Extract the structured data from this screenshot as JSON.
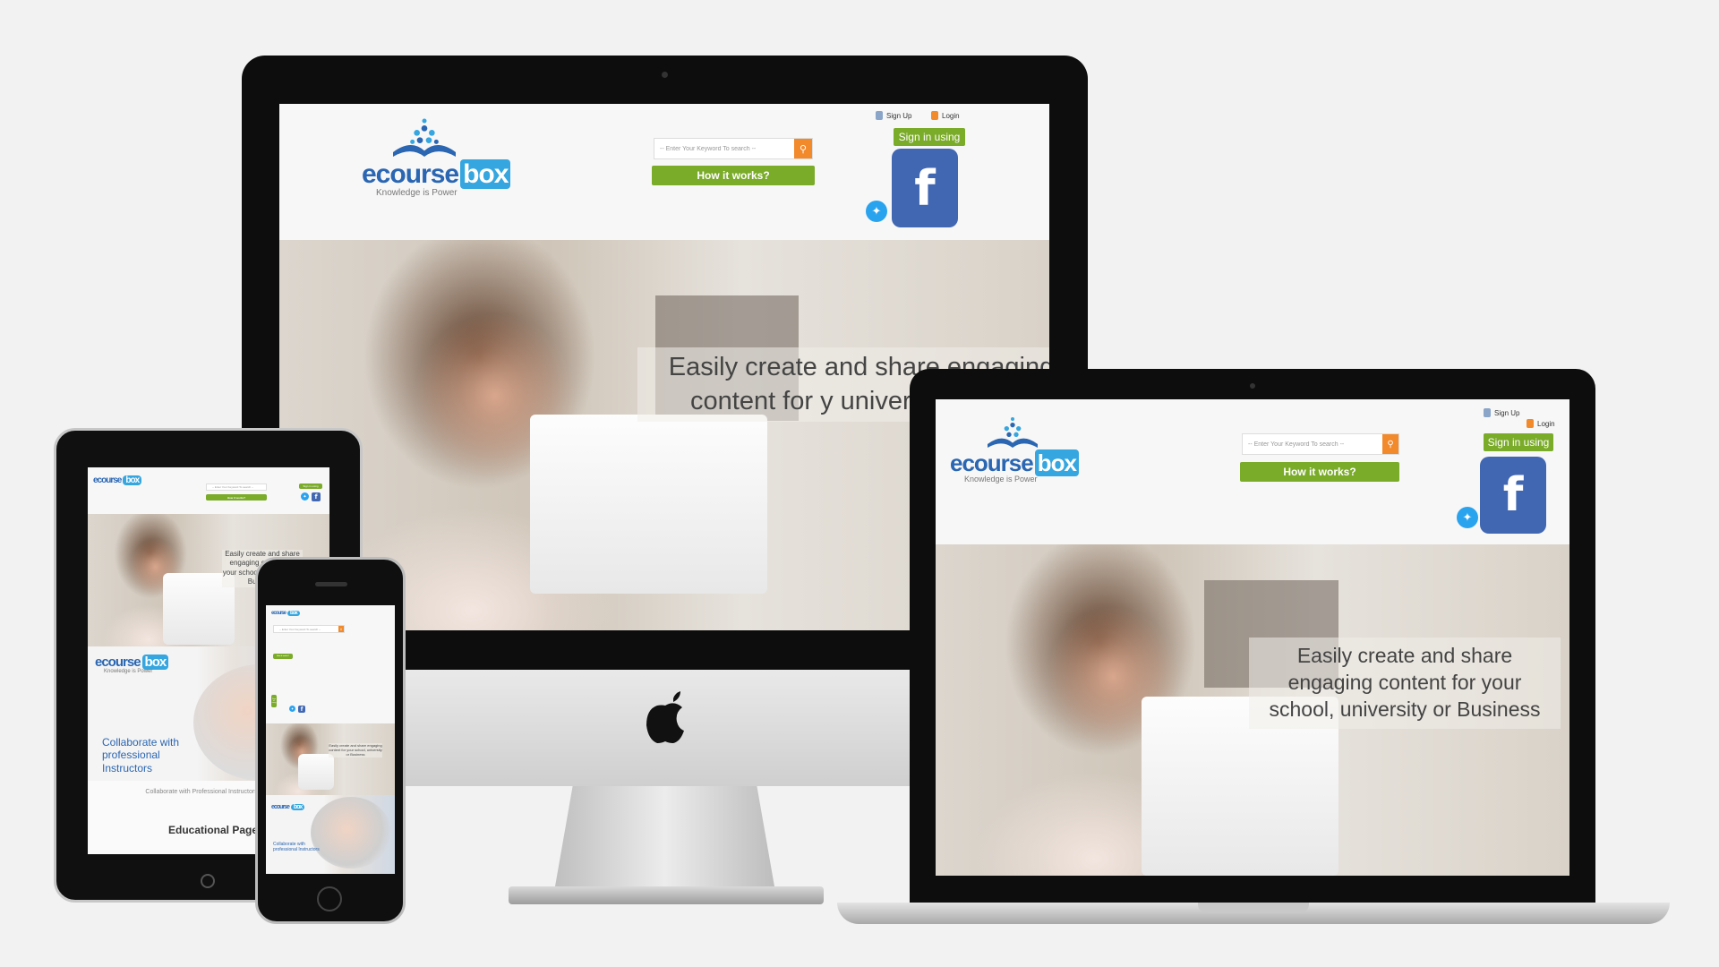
{
  "site": {
    "logo_course": "ecourse",
    "logo_box": "box",
    "tagline": "Knowledge is Power",
    "search_placeholder": "-- Enter Your Keyword To search --",
    "how_it_works": "How it works?",
    "sign_in_using": "Sign in using",
    "sign_up": "Sign Up",
    "login": "Login",
    "fb_glyph": "f",
    "hero_text": "Easily create and share engaging content for your school, university or Business",
    "collab_text": "Collaborate with professional Instructors",
    "collab_sub": "Collaborate with Professional Instructors Anywhere In your Circle",
    "edu_title": "Educational Page About Y"
  },
  "imac_hero_visible": "Easily create and share engaging content for y university or Bus",
  "icons": [
    "search-icon",
    "facebook-icon",
    "twitter-icon",
    "apple-logo-icon",
    "user-icon",
    "lock-icon"
  ],
  "colors": {
    "brand_blue": "#2a66b2",
    "box_blue": "#35a6df",
    "green": "#7aab29",
    "orange": "#f2892b",
    "facebook": "#4167b2",
    "twitter": "#2aa3ef"
  }
}
